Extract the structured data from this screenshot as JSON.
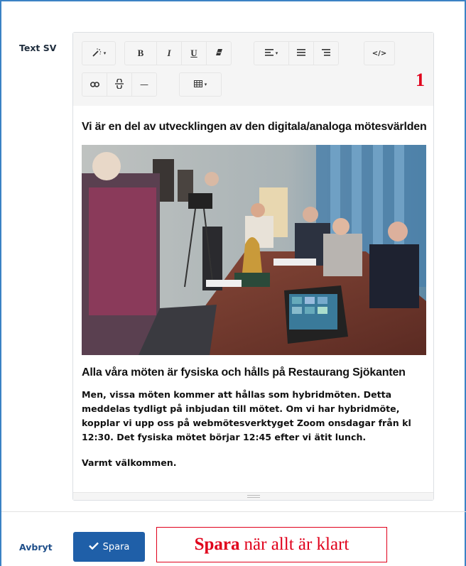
{
  "field": {
    "label": "Text SV"
  },
  "toolbar": {
    "style_caret": "▾",
    "align_caret": "▾",
    "table_caret": "▾",
    "bold": "B",
    "italic": "I",
    "underline": "U",
    "code": "</>",
    "hr": "—"
  },
  "annotation": {
    "number": "1"
  },
  "content": {
    "heading": "Vi är en del av utvecklingen av den digitala/analoga mötesvärlden",
    "subheading": "Alla våra möten är fysiska och hålls på Restaurang Sjökanten",
    "paragraph": "Men, vissa möten kommer att hållas som hybridmöten. Detta meddelas tydligt på inbjudan till mötet. Om vi har hybridmöte, kopplar vi upp oss på webmötesverktyget Zoom onsdagar från kl 12:30. Det fysiska mötet börjar 12:45 efter vi ätit lunch.",
    "closing": "Varmt välkommen."
  },
  "actions": {
    "cancel_label": "Avbryt",
    "save_label": "Spara"
  },
  "callout": {
    "bold_word": "Spara",
    "rest": "när allt är klart"
  },
  "colors": {
    "accent": "#1f5fa8",
    "frame": "#3b82c4",
    "annotation_red": "#e0001b"
  }
}
